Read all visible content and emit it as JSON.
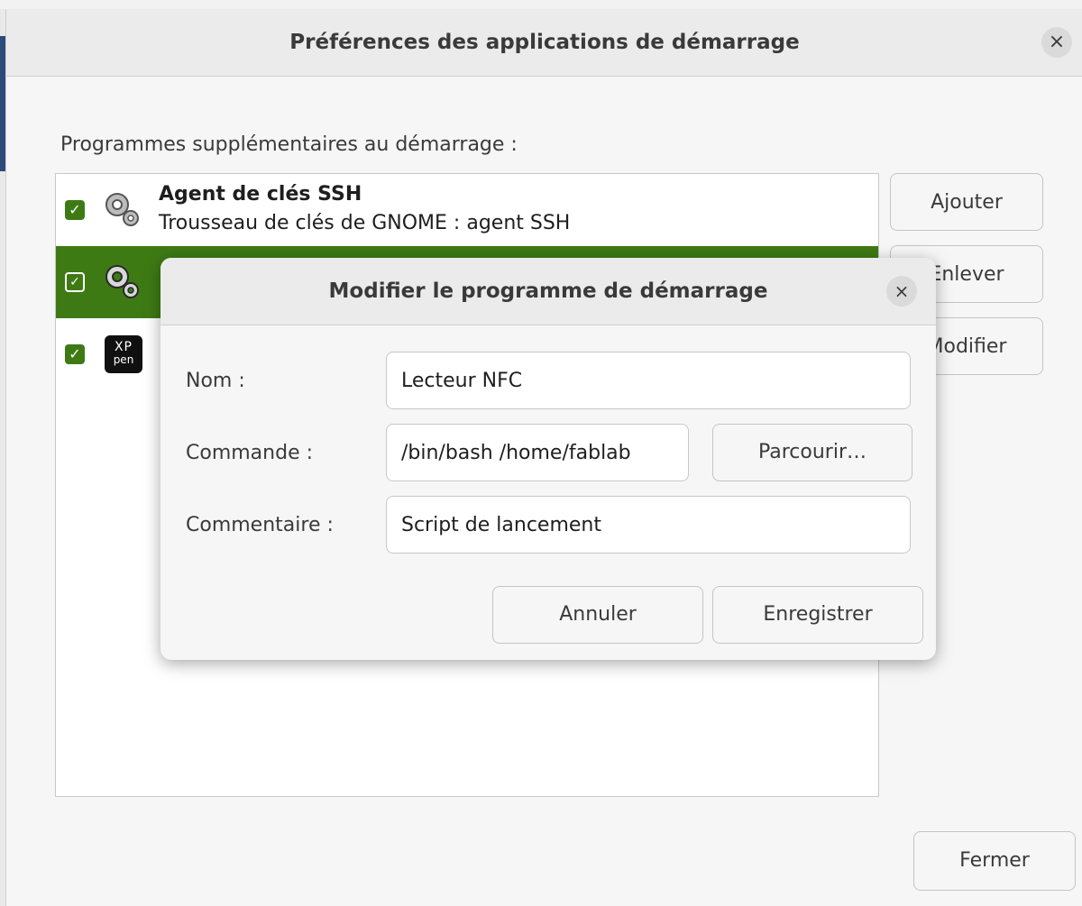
{
  "main_window": {
    "title": "Préférences des applications de démarrage",
    "section_label": "Programmes supplémentaires au démarrage :",
    "programs": [
      {
        "title": "Agent de clés SSH",
        "subtitle": "Trousseau de clés de GNOME : agent SSH",
        "checked": true,
        "icon": "gears-icon"
      },
      {
        "title": "",
        "subtitle": "",
        "checked": true,
        "icon": "gears-icon",
        "selected": true
      },
      {
        "title": "",
        "subtitle": "",
        "checked": true,
        "icon": "xp-pen-logo"
      }
    ],
    "buttons": {
      "add": "Ajouter",
      "remove": "Enlever",
      "edit": "Modifier",
      "close": "Fermer"
    },
    "checkmark": "✓",
    "close_glyph": "×"
  },
  "xp_logo": {
    "line1": "XP",
    "line2": "pen"
  },
  "dialog": {
    "title": "Modifier le programme de démarrage",
    "fields": {
      "name": {
        "label": "Nom :",
        "value": "Lecteur NFC"
      },
      "command": {
        "label": "Commande :",
        "value": "/bin/bash /home/fablab"
      },
      "comment": {
        "label": "Commentaire :",
        "value": "Script de lancement"
      }
    },
    "browse": "Parcourir…",
    "cancel": "Annuler",
    "save": "Enregistrer",
    "close_glyph": "×"
  },
  "colors": {
    "accent": "#3e7a14",
    "window_bg": "#f6f6f6",
    "header_bg": "#ebebeb"
  }
}
